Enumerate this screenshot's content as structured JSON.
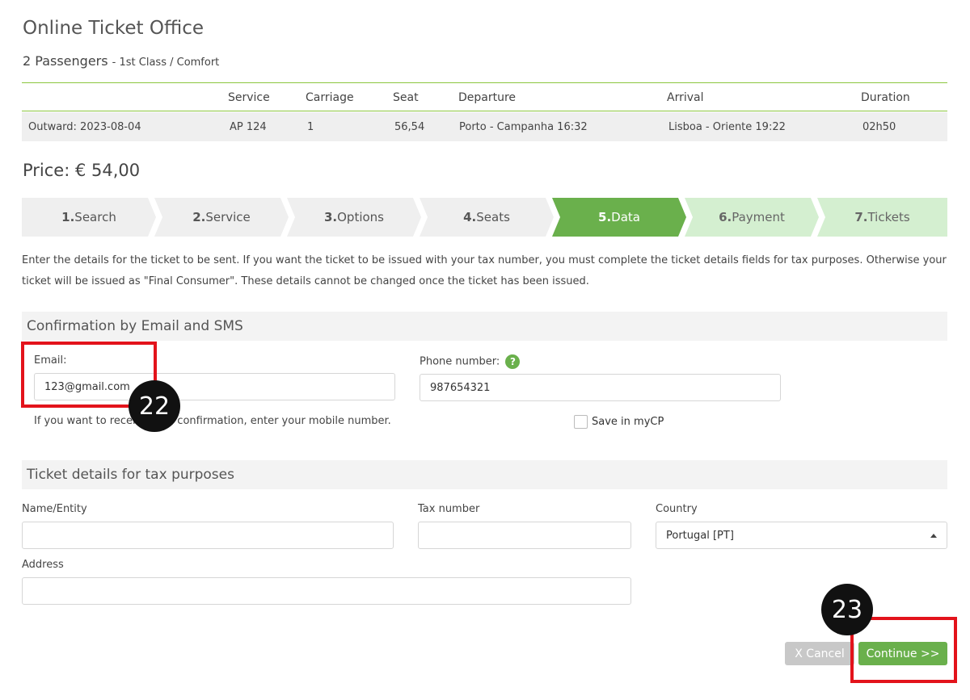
{
  "page": {
    "title": "Online Ticket Office",
    "passengers": "2 Passengers",
    "class_info": "- 1st Class / Comfort",
    "price": "Price: € 54,00"
  },
  "journey": {
    "headers": [
      "Service",
      "Carriage",
      "Seat",
      "Departure",
      "Arrival",
      "Duration"
    ],
    "row": {
      "label": "Outward: 2023-08-04",
      "service": "AP 124",
      "carriage": "1",
      "seat": "56,54",
      "departure": "Porto - Campanha 16:32",
      "arrival": "Lisboa - Oriente 19:22",
      "duration": "02h50"
    }
  },
  "steps": [
    {
      "num": "1.",
      "label": "Search"
    },
    {
      "num": "2.",
      "label": "Service"
    },
    {
      "num": "3.",
      "label": "Options"
    },
    {
      "num": "4.",
      "label": "Seats"
    },
    {
      "num": "5.",
      "label": "Data"
    },
    {
      "num": "6.",
      "label": "Payment"
    },
    {
      "num": "7.",
      "label": "Tickets"
    }
  ],
  "intro_text": "Enter the details for the ticket to be sent. If you want the ticket to be issued with your tax number, you must complete the ticket details fields for tax purposes. Otherwise your ticket will be issued as \"Final Consumer\". These details cannot be changed once the ticket has been issued.",
  "confirmation": {
    "heading": "Confirmation by Email and SMS",
    "email_label": "Email:",
    "email_value": "123@gmail.com",
    "phone_label": "Phone number:",
    "phone_help": "?",
    "phone_value": "987654321",
    "hint": "If you want to receive SMS confirmation, enter your mobile number.",
    "save_label": "Save in myCP"
  },
  "tax": {
    "heading": "Ticket details for tax purposes",
    "name_label": "Name/Entity",
    "name_value": "",
    "tax_label": "Tax number",
    "tax_value": "",
    "country_label": "Country",
    "country_value": "Portugal [PT]",
    "address_label": "Address",
    "address_value": ""
  },
  "actions": {
    "cancel_label": "X Cancel",
    "continue_label": "Continue >>"
  },
  "annotations": {
    "marker_email": "22",
    "marker_continue": "23",
    "highlight_color": "#e3131b"
  },
  "colors": {
    "accent": "#6ab04c",
    "accent_light": "#d4efd0",
    "step_default": "#efefef"
  }
}
